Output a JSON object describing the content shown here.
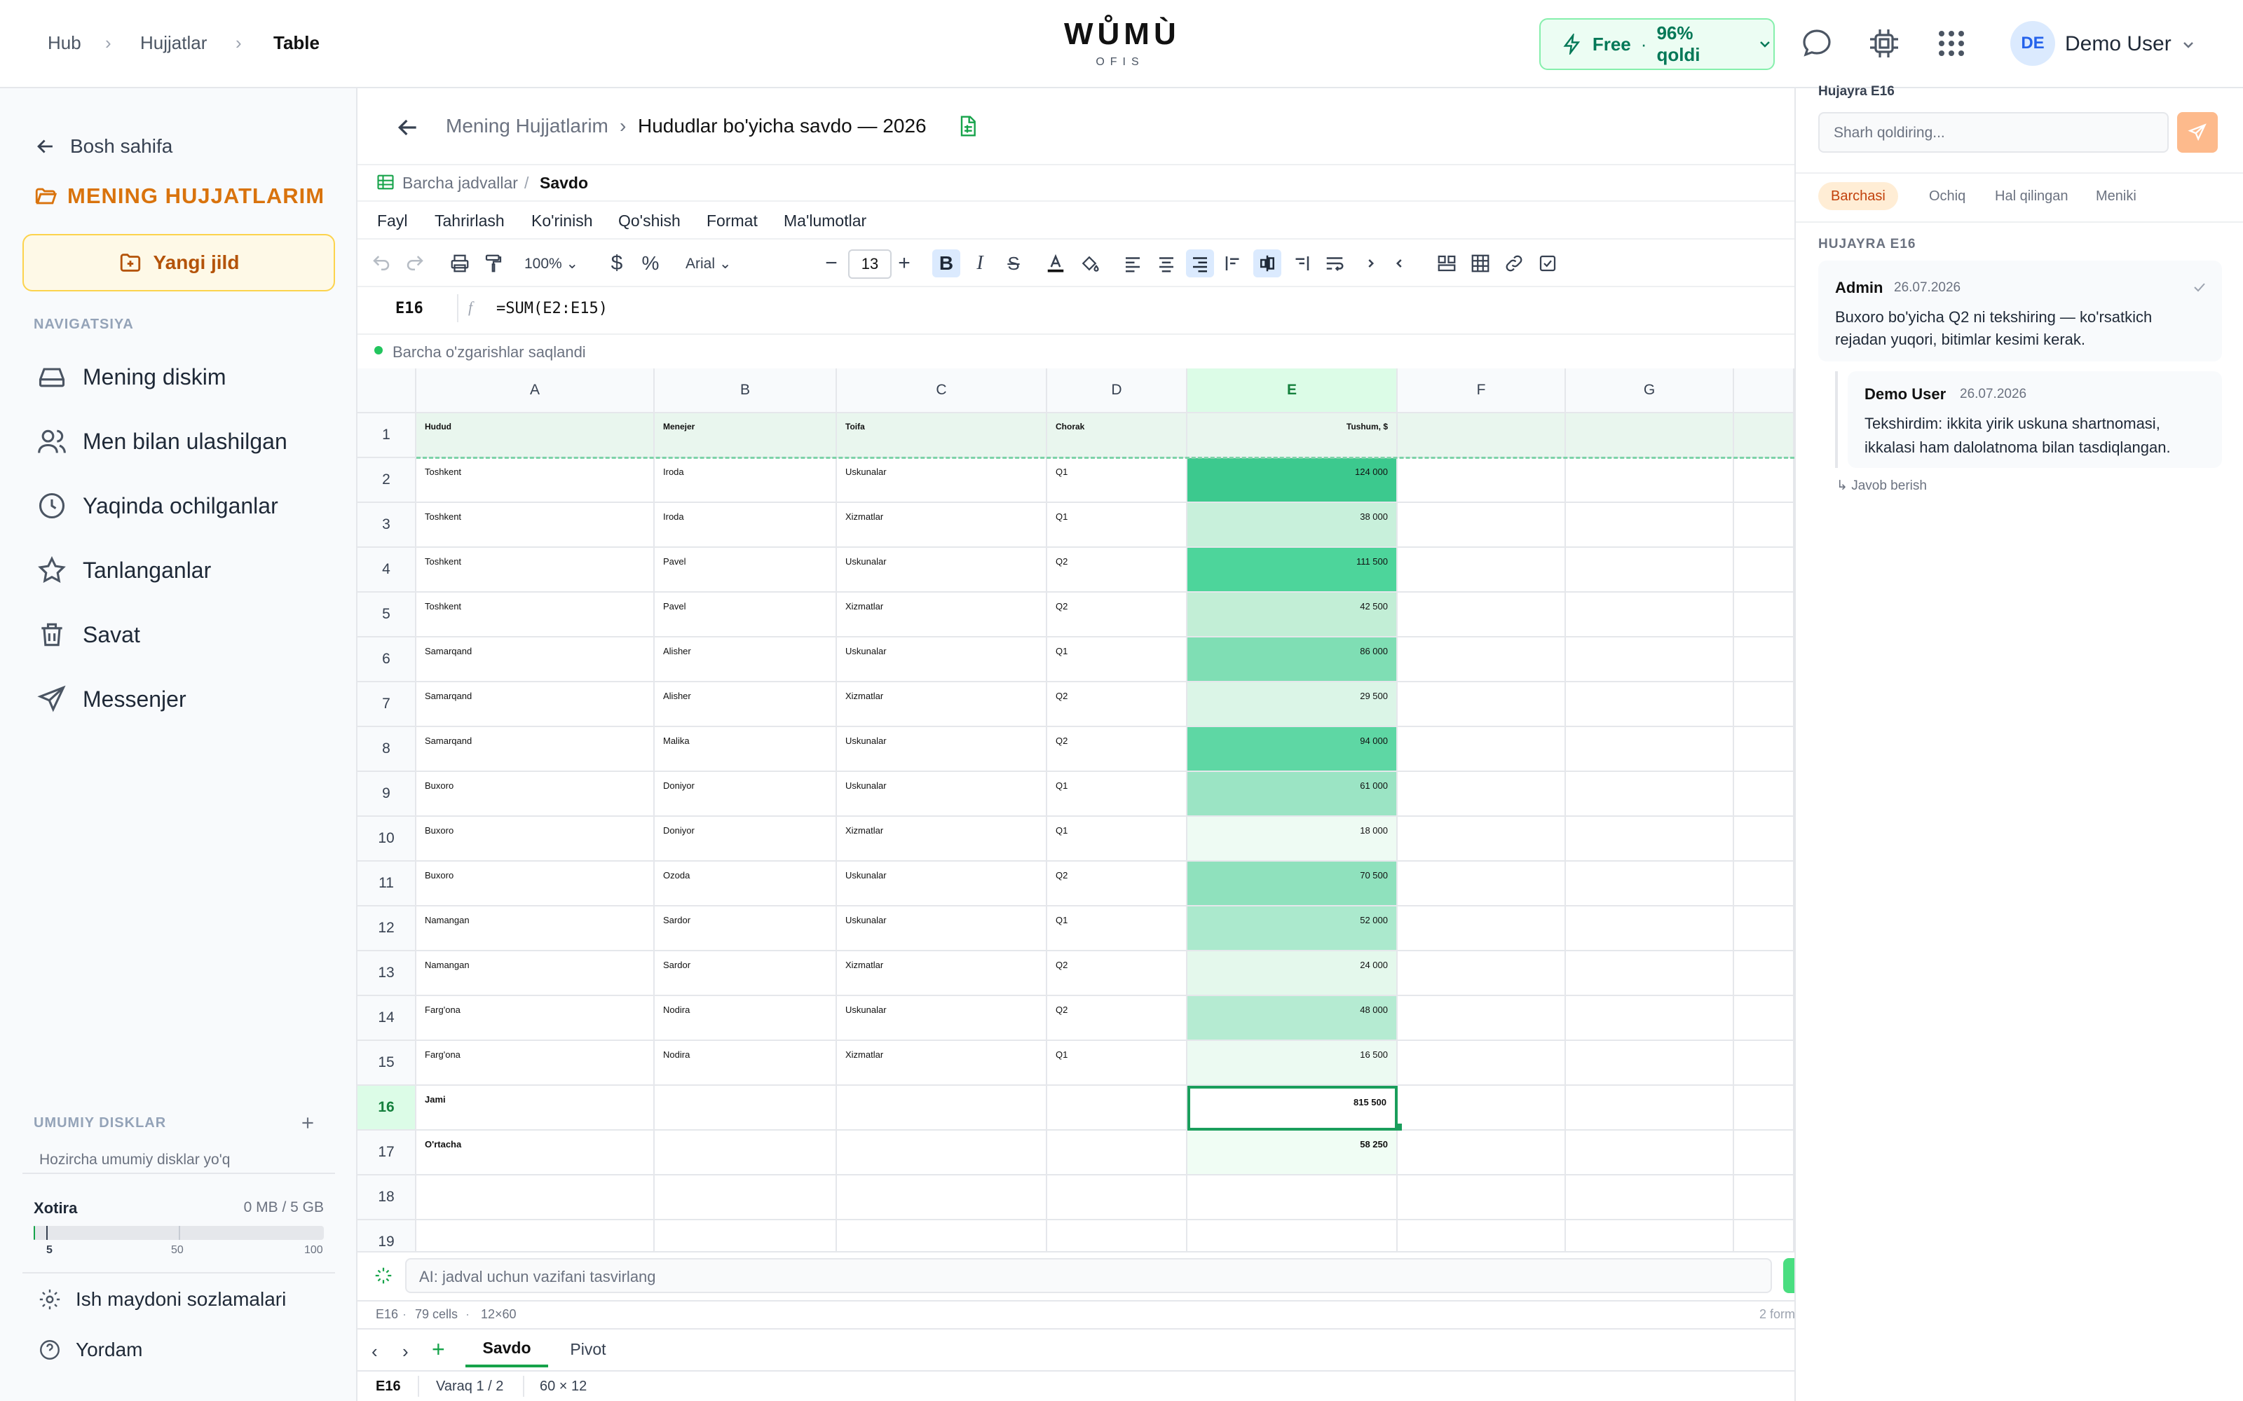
{
  "breadcrumb": {
    "items": [
      "Hub",
      "Hujjatlar",
      "Table"
    ]
  },
  "brand": {
    "name": "WŮMÙ",
    "sub": "OFIS"
  },
  "plan": {
    "label": "Free",
    "sep": "·",
    "remaining": "96% qoldi"
  },
  "user": {
    "initials": "DE",
    "name": "Demo User"
  },
  "sidebar": {
    "back": "Bosh sahifa",
    "folder_title": "MENING HUJJATLARIM",
    "new_folder": "Yangi jild",
    "nav_label": "NAVIGATSIYA",
    "items": [
      {
        "label": "Mening diskim",
        "icon": "drive-icon"
      },
      {
        "label": "Men bilan ulashilgan",
        "icon": "users-icon"
      },
      {
        "label": "Yaqinda ochilganlar",
        "icon": "clock-icon"
      },
      {
        "label": "Tanlanganlar",
        "icon": "star-icon"
      },
      {
        "label": "Savat",
        "icon": "trash-icon"
      },
      {
        "label": "Messenjer",
        "icon": "send-icon"
      }
    ],
    "shared_label": "UMUMIY DISKLAR",
    "shared_empty": "Hozircha umumiy disklar yo'q",
    "storage_label": "Xotira",
    "storage_value": "0 MB / 5 GB",
    "storage_fraction": 0.0,
    "storage_ticks": [
      "5",
      "50",
      "100"
    ],
    "settings": "Ish maydoni sozlamalari",
    "help": "Yordam"
  },
  "doc": {
    "parent": "Mening Hujjatlarim",
    "title": "Hududlar bo'yicha savdo — 2026",
    "tables_link": "Barcha jadvallar",
    "tables_sep": "/",
    "sheet_current": "Savdo",
    "menu": [
      "Fayl",
      "Tahrirlash",
      "Ko'rinish",
      "Qo'shish",
      "Format",
      "Ma'lumotlar"
    ],
    "zoom": "100%",
    "font": "Arial",
    "font_size": "13",
    "cell_ref": "E16",
    "formula_fx": "f",
    "formula": "=SUM(E2:E15)",
    "saved": "Barcha o'zgarishlar saqlandi",
    "ai_placeholder": "AI: jadval uchun vazifani tasvirlang",
    "status_cell": "E16",
    "status_cells": "79 cells",
    "status_size": "12×60",
    "status_right": "2 form",
    "sheets": [
      "Savdo",
      "Pivot"
    ],
    "footer_cell": "E16",
    "footer_sheet": "Varaq 1 / 2",
    "footer_size": "60 × 12"
  },
  "grid": {
    "columns": [
      "A",
      "B",
      "C",
      "D",
      "E",
      "F",
      "G"
    ],
    "headers": [
      "Hudud",
      "Menejer",
      "Toifa",
      "Chorak",
      "Tushum, $"
    ],
    "rows": [
      [
        "Toshkent",
        "Iroda",
        "Uskunalar",
        "Q1",
        "124 000"
      ],
      [
        "Toshkent",
        "Iroda",
        "Xizmatlar",
        "Q1",
        "38 000"
      ],
      [
        "Toshkent",
        "Pavel",
        "Uskunalar",
        "Q2",
        "111 500"
      ],
      [
        "Toshkent",
        "Pavel",
        "Xizmatlar",
        "Q2",
        "42 500"
      ],
      [
        "Samarqand",
        "Alisher",
        "Uskunalar",
        "Q1",
        "86 000"
      ],
      [
        "Samarqand",
        "Alisher",
        "Xizmatlar",
        "Q2",
        "29 500"
      ],
      [
        "Samarqand",
        "Malika",
        "Uskunalar",
        "Q2",
        "94 000"
      ],
      [
        "Buxoro",
        "Doniyor",
        "Uskunalar",
        "Q1",
        "61 000"
      ],
      [
        "Buxoro",
        "Doniyor",
        "Xizmatlar",
        "Q1",
        "18 000"
      ],
      [
        "Buxoro",
        "Ozoda",
        "Uskunalar",
        "Q2",
        "70 500"
      ],
      [
        "Namangan",
        "Sardor",
        "Uskunalar",
        "Q1",
        "52 000"
      ],
      [
        "Namangan",
        "Sardor",
        "Xizmatlar",
        "Q2",
        "24 000"
      ],
      [
        "Farg'ona",
        "Nodira",
        "Uskunalar",
        "Q2",
        "48 000"
      ],
      [
        "Farg'ona",
        "Nodira",
        "Xizmatlar",
        "Q1",
        "16 500"
      ]
    ],
    "total_label": "Jami",
    "total_value": "815 500",
    "avg_label": "O'rtacha",
    "avg_value": "58 250",
    "row_numbers": [
      "1",
      "2",
      "3",
      "4",
      "5",
      "6",
      "7",
      "8",
      "9",
      "10",
      "11",
      "12",
      "13",
      "14",
      "15",
      "16",
      "17",
      "18",
      "19"
    ],
    "heat_colors": [
      "#3cc98e",
      "#c8f0db",
      "#4dd59b",
      "#c2eed6",
      "#7fdeb4",
      "#dbf5e7",
      "#5ed7a4",
      "#9be4c4",
      "#eefbf3",
      "#8fe1bd",
      "#abe9cd",
      "#e4f8ec",
      "#b5ebd2",
      "#ecfaf2"
    ]
  },
  "comments": {
    "cell_label": "Hujayra E16",
    "placeholder": "Sharh qoldiring...",
    "filters": [
      "Barchasi",
      "Ochiq",
      "Hal qilingan",
      "Meniki"
    ],
    "thread_label": "HUJAYRA E16",
    "items": [
      {
        "author": "Admin",
        "date": "26.07.2026",
        "text_1": "Buxoro bo'yicha Q2 ni tekshiring — ko'rsatkich",
        "text_2": "rejadan yuqori, bitimlar kesimi kerak."
      },
      {
        "author": "Demo User",
        "date": "26.07.2026",
        "text_1": "Tekshirdim: ikkita yirik uskuna shartnomasi,",
        "text_2": "ikkalasi ham dalolatnoma bilan tasdiqlangan."
      }
    ],
    "reply": "Javob berish"
  },
  "colors": {
    "accent_orange": "#d9730d",
    "green": "#16a34a",
    "selection": "#1a9e5c"
  }
}
